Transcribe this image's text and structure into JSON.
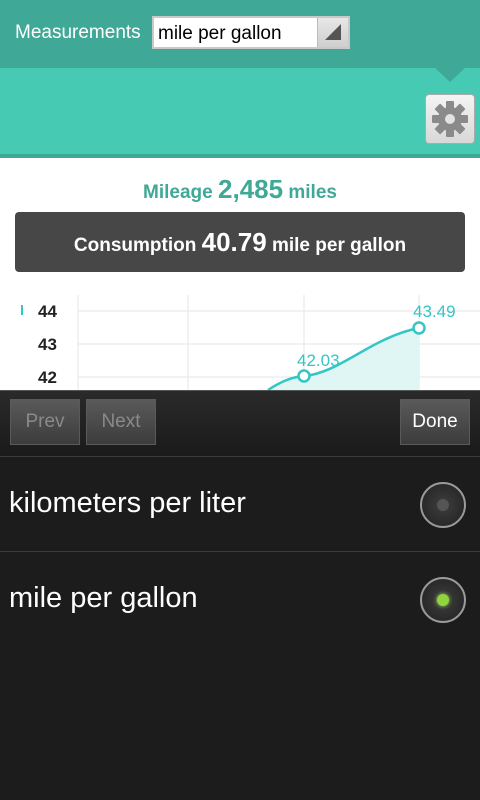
{
  "header": {
    "measurements_label": "Measurements",
    "select_value": "mile per gallon"
  },
  "stats": {
    "mileage_label": "Mileage",
    "mileage_value": "2,485",
    "mileage_unit": "miles",
    "consumption_label": "Consumption",
    "consumption_value": "40.79",
    "consumption_unit": "mile per gallon"
  },
  "chart_data": {
    "type": "line",
    "y_ticks": [
      "44",
      "43",
      "42"
    ],
    "points": [
      {
        "label": "42.03",
        "value": 42.03
      },
      {
        "label": "43.49",
        "value": 43.49
      }
    ],
    "color": "#33c6c4",
    "grid": true
  },
  "picker": {
    "prev_label": "Prev",
    "next_label": "Next",
    "done_label": "Done",
    "options": [
      {
        "label": "kilometers per liter",
        "checked": false
      },
      {
        "label": "mile per gallon",
        "checked": true
      }
    ]
  },
  "colors": {
    "brand_dark": "#3fa896",
    "brand_light": "#47cab3",
    "chart_line": "#33c6c4"
  }
}
